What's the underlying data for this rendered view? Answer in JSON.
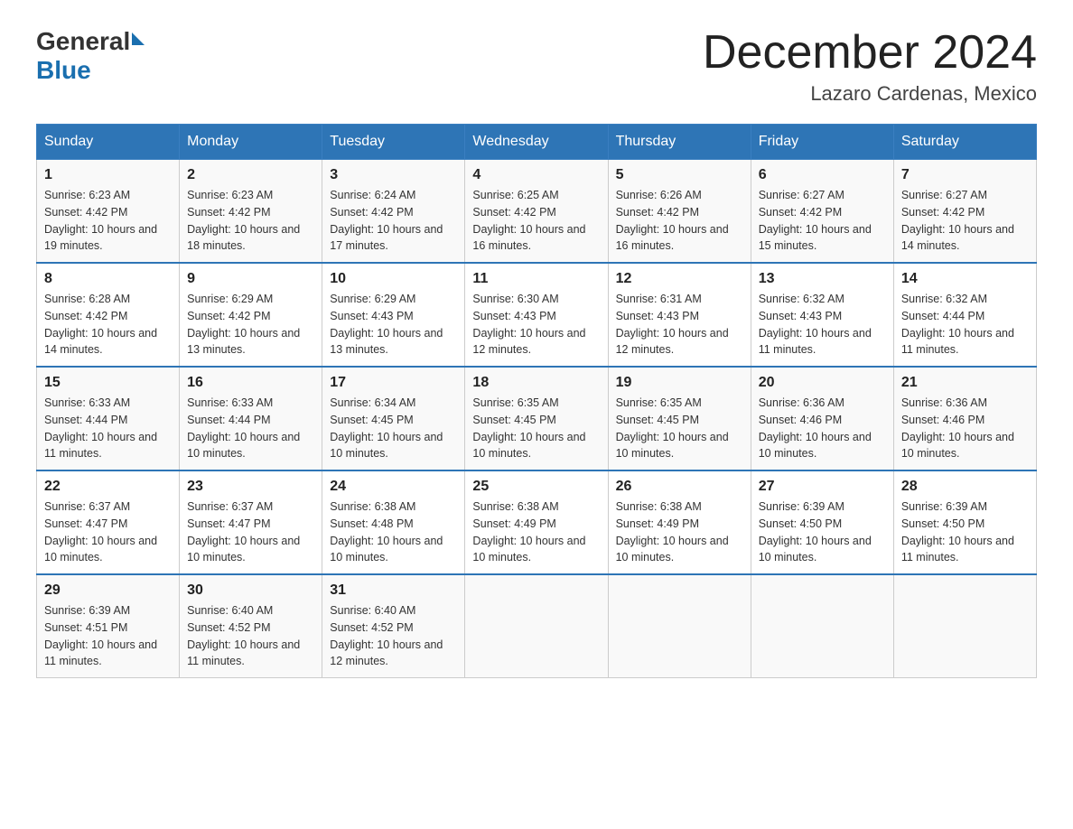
{
  "logo": {
    "text_general": "General",
    "text_blue": "Blue",
    "triangle": "▶"
  },
  "title": "December 2024",
  "subtitle": "Lazaro Cardenas, Mexico",
  "days_of_week": [
    "Sunday",
    "Monday",
    "Tuesday",
    "Wednesday",
    "Thursday",
    "Friday",
    "Saturday"
  ],
  "weeks": [
    [
      {
        "day": "1",
        "sunrise": "6:23 AM",
        "sunset": "4:42 PM",
        "daylight": "10 hours and 19 minutes."
      },
      {
        "day": "2",
        "sunrise": "6:23 AM",
        "sunset": "4:42 PM",
        "daylight": "10 hours and 18 minutes."
      },
      {
        "day": "3",
        "sunrise": "6:24 AM",
        "sunset": "4:42 PM",
        "daylight": "10 hours and 17 minutes."
      },
      {
        "day": "4",
        "sunrise": "6:25 AM",
        "sunset": "4:42 PM",
        "daylight": "10 hours and 16 minutes."
      },
      {
        "day": "5",
        "sunrise": "6:26 AM",
        "sunset": "4:42 PM",
        "daylight": "10 hours and 16 minutes."
      },
      {
        "day": "6",
        "sunrise": "6:27 AM",
        "sunset": "4:42 PM",
        "daylight": "10 hours and 15 minutes."
      },
      {
        "day": "7",
        "sunrise": "6:27 AM",
        "sunset": "4:42 PM",
        "daylight": "10 hours and 14 minutes."
      }
    ],
    [
      {
        "day": "8",
        "sunrise": "6:28 AM",
        "sunset": "4:42 PM",
        "daylight": "10 hours and 14 minutes."
      },
      {
        "day": "9",
        "sunrise": "6:29 AM",
        "sunset": "4:42 PM",
        "daylight": "10 hours and 13 minutes."
      },
      {
        "day": "10",
        "sunrise": "6:29 AM",
        "sunset": "4:43 PM",
        "daylight": "10 hours and 13 minutes."
      },
      {
        "day": "11",
        "sunrise": "6:30 AM",
        "sunset": "4:43 PM",
        "daylight": "10 hours and 12 minutes."
      },
      {
        "day": "12",
        "sunrise": "6:31 AM",
        "sunset": "4:43 PM",
        "daylight": "10 hours and 12 minutes."
      },
      {
        "day": "13",
        "sunrise": "6:32 AM",
        "sunset": "4:43 PM",
        "daylight": "10 hours and 11 minutes."
      },
      {
        "day": "14",
        "sunrise": "6:32 AM",
        "sunset": "4:44 PM",
        "daylight": "10 hours and 11 minutes."
      }
    ],
    [
      {
        "day": "15",
        "sunrise": "6:33 AM",
        "sunset": "4:44 PM",
        "daylight": "10 hours and 11 minutes."
      },
      {
        "day": "16",
        "sunrise": "6:33 AM",
        "sunset": "4:44 PM",
        "daylight": "10 hours and 10 minutes."
      },
      {
        "day": "17",
        "sunrise": "6:34 AM",
        "sunset": "4:45 PM",
        "daylight": "10 hours and 10 minutes."
      },
      {
        "day": "18",
        "sunrise": "6:35 AM",
        "sunset": "4:45 PM",
        "daylight": "10 hours and 10 minutes."
      },
      {
        "day": "19",
        "sunrise": "6:35 AM",
        "sunset": "4:45 PM",
        "daylight": "10 hours and 10 minutes."
      },
      {
        "day": "20",
        "sunrise": "6:36 AM",
        "sunset": "4:46 PM",
        "daylight": "10 hours and 10 minutes."
      },
      {
        "day": "21",
        "sunrise": "6:36 AM",
        "sunset": "4:46 PM",
        "daylight": "10 hours and 10 minutes."
      }
    ],
    [
      {
        "day": "22",
        "sunrise": "6:37 AM",
        "sunset": "4:47 PM",
        "daylight": "10 hours and 10 minutes."
      },
      {
        "day": "23",
        "sunrise": "6:37 AM",
        "sunset": "4:47 PM",
        "daylight": "10 hours and 10 minutes."
      },
      {
        "day": "24",
        "sunrise": "6:38 AM",
        "sunset": "4:48 PM",
        "daylight": "10 hours and 10 minutes."
      },
      {
        "day": "25",
        "sunrise": "6:38 AM",
        "sunset": "4:49 PM",
        "daylight": "10 hours and 10 minutes."
      },
      {
        "day": "26",
        "sunrise": "6:38 AM",
        "sunset": "4:49 PM",
        "daylight": "10 hours and 10 minutes."
      },
      {
        "day": "27",
        "sunrise": "6:39 AM",
        "sunset": "4:50 PM",
        "daylight": "10 hours and 10 minutes."
      },
      {
        "day": "28",
        "sunrise": "6:39 AM",
        "sunset": "4:50 PM",
        "daylight": "10 hours and 11 minutes."
      }
    ],
    [
      {
        "day": "29",
        "sunrise": "6:39 AM",
        "sunset": "4:51 PM",
        "daylight": "10 hours and 11 minutes."
      },
      {
        "day": "30",
        "sunrise": "6:40 AM",
        "sunset": "4:52 PM",
        "daylight": "10 hours and 11 minutes."
      },
      {
        "day": "31",
        "sunrise": "6:40 AM",
        "sunset": "4:52 PM",
        "daylight": "10 hours and 12 minutes."
      },
      null,
      null,
      null,
      null
    ]
  ]
}
